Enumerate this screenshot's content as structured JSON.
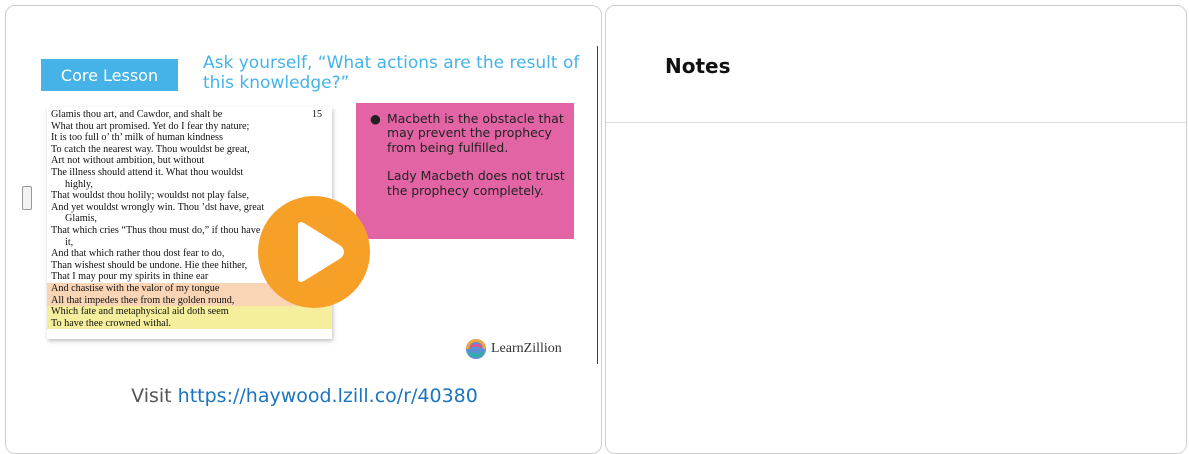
{
  "video": {
    "slide": {
      "badge": "Core Lesson",
      "heading": "Ask yourself, “What actions are the result of this knowledge?”",
      "line_number": "15",
      "text_lines": [
        {
          "text": "Glamis thou art, and Cawdor, and shalt be",
          "indent": false,
          "highlight": ""
        },
        {
          "text": "What thou art promised. Yet do I fear thy nature;",
          "indent": false,
          "highlight": ""
        },
        {
          "text": "It is too full o’ th’ milk of human kindness",
          "indent": false,
          "highlight": ""
        },
        {
          "text": "To catch the nearest way. Thou wouldst be great,",
          "indent": false,
          "highlight": ""
        },
        {
          "text": "Art not without ambition, but without",
          "indent": false,
          "highlight": ""
        },
        {
          "text": "The illness should attend it. What thou wouldst",
          "indent": false,
          "highlight": ""
        },
        {
          "text": "highly,",
          "indent": true,
          "highlight": ""
        },
        {
          "text": "That wouldst thou holily; wouldst not play false,",
          "indent": false,
          "highlight": ""
        },
        {
          "text": "And yet wouldst wrongly win. Thou ’dst have, great",
          "indent": false,
          "highlight": ""
        },
        {
          "text": "Glamis,",
          "indent": true,
          "highlight": ""
        },
        {
          "text": "That which cries “Thus thou must do,” if thou have",
          "indent": false,
          "highlight": ""
        },
        {
          "text": "it,",
          "indent": true,
          "highlight": ""
        },
        {
          "text": "And that which rather thou dost fear to do,",
          "indent": false,
          "highlight": ""
        },
        {
          "text": "Than wishest should be undone. Hie thee hither,",
          "indent": false,
          "highlight": ""
        },
        {
          "text": "That I may pour my spirits in thine ear",
          "indent": false,
          "highlight": ""
        },
        {
          "text": "And chastise with the valor of my tongue",
          "indent": false,
          "highlight": "orange"
        },
        {
          "text": "All that impedes thee from the golden round,",
          "indent": false,
          "highlight": "orange"
        },
        {
          "text": "Which fate and metaphysical aid doth seem",
          "indent": false,
          "highlight": "yellow"
        },
        {
          "text": "To have thee crowned withal.",
          "indent": false,
          "highlight": "yellow"
        }
      ],
      "pink_bullet": "Macbeth is the obstacle that may prevent the prophecy from being fulfilled.",
      "pink_paragraph": "Lady Macbeth does not trust the prophecy completely.",
      "logo_text": "LearnZillion"
    },
    "visit_prefix": "Visit ",
    "visit_url": "https://haywood.lzill.co/r/40380"
  },
  "notes": {
    "title": "Notes"
  },
  "colors": {
    "badge": "#45b3e7",
    "pink_box": "#e264a4",
    "play": "#f7a028",
    "link": "#1b74c2"
  }
}
